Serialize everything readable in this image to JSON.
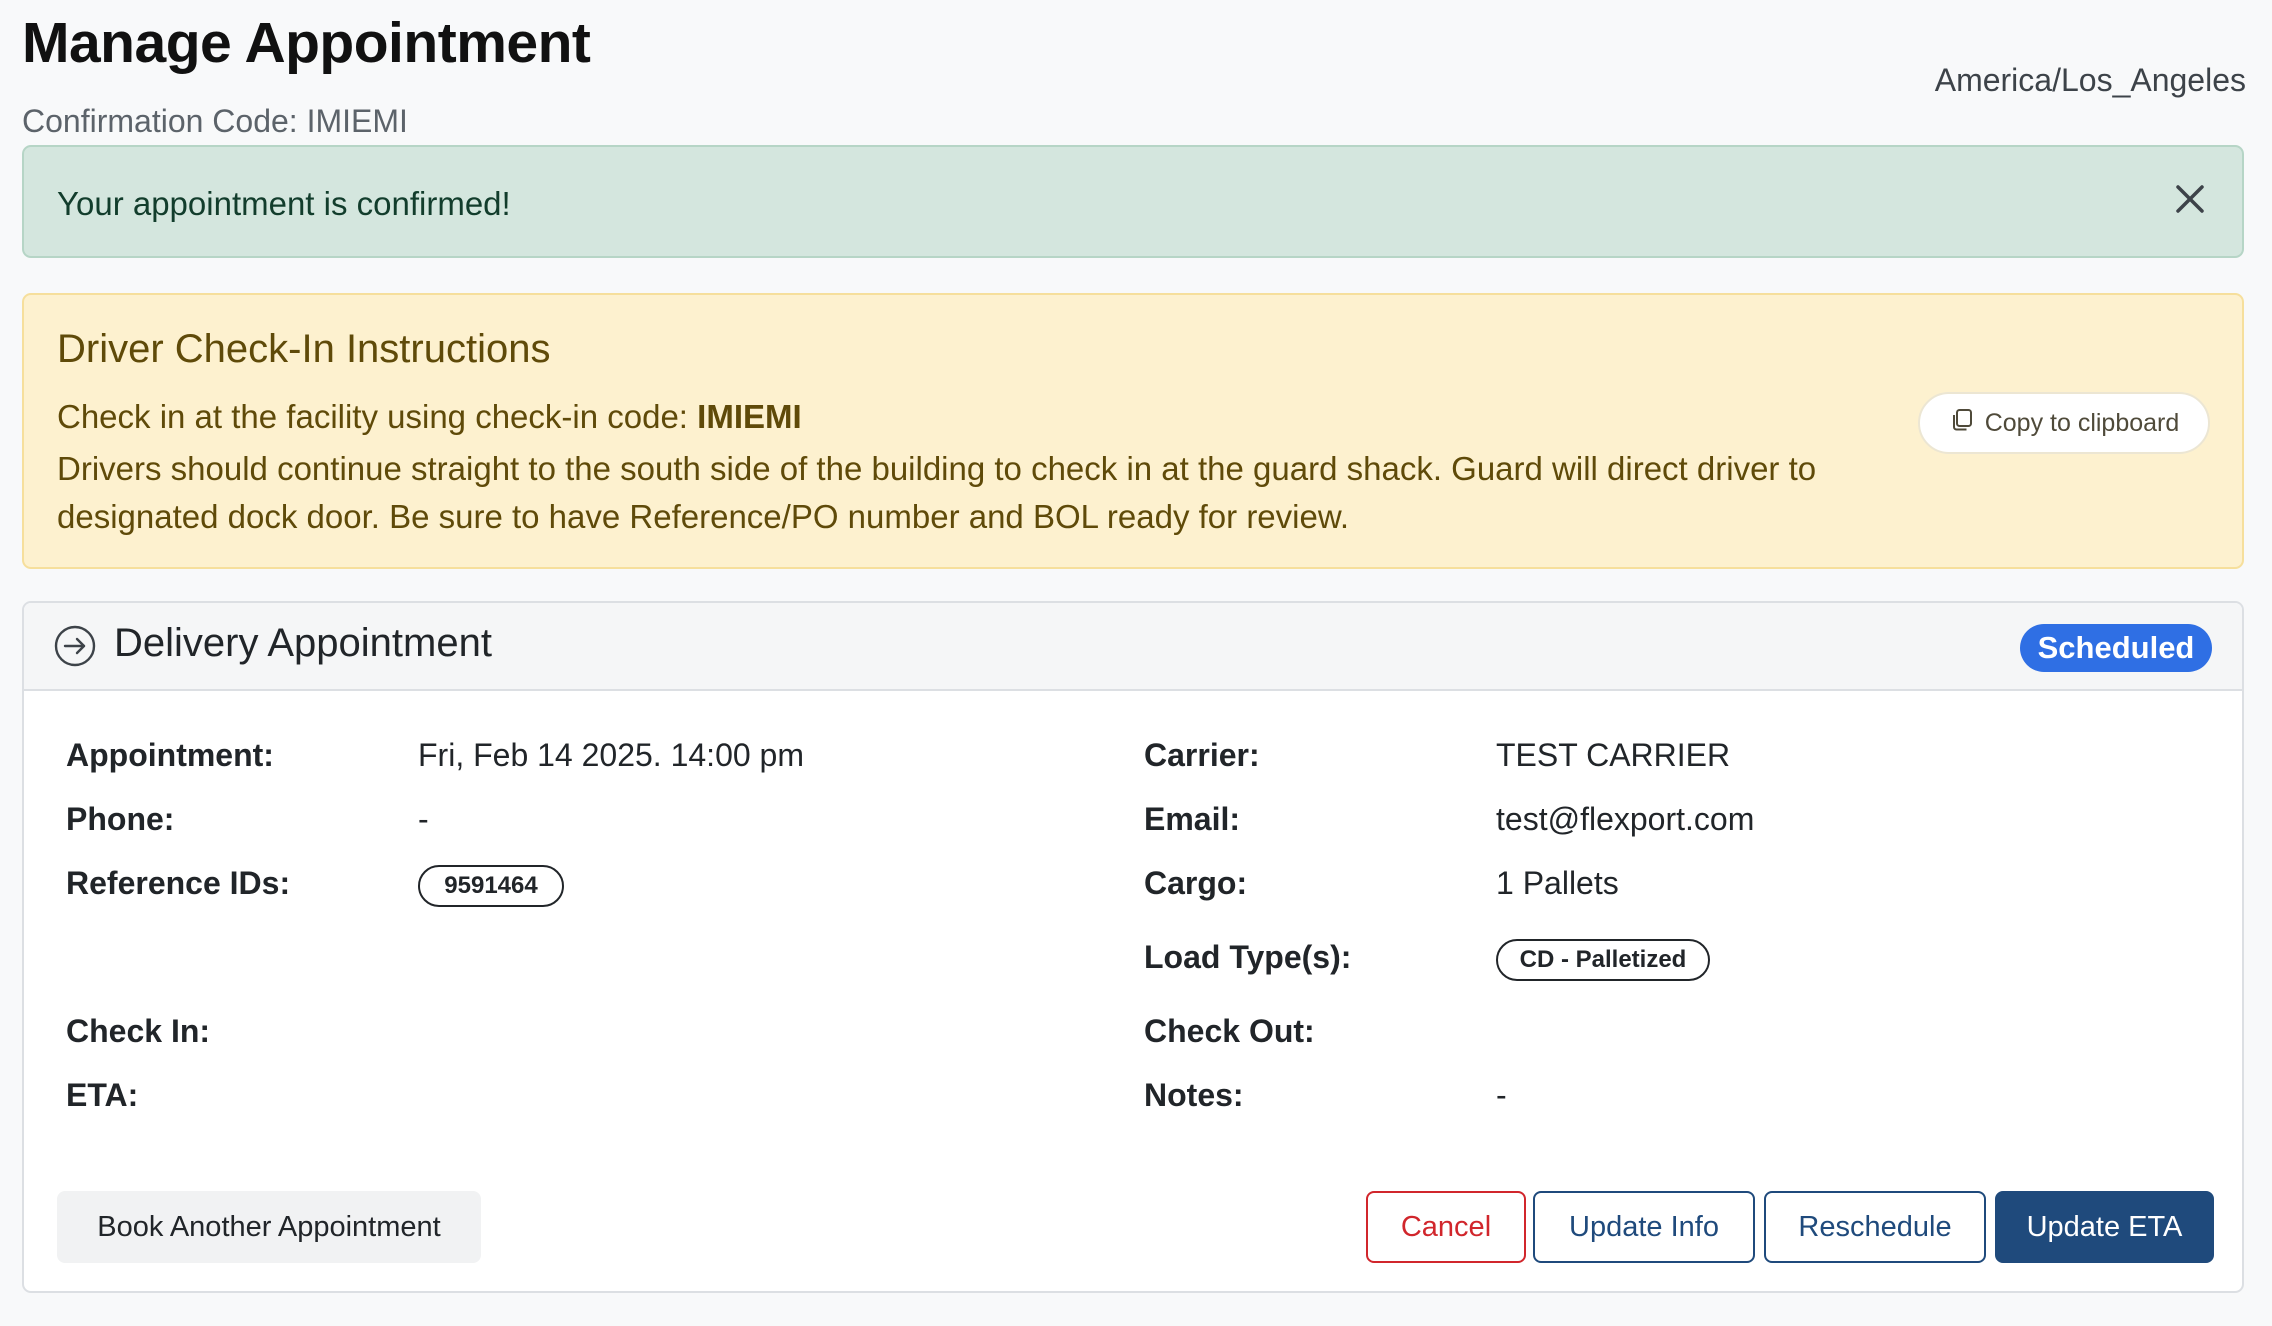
{
  "header": {
    "title": "Manage Appointment",
    "confirmation_label": "Confirmation Code:",
    "confirmation_code": "IMIEMI",
    "timezone": "America/Los_Angeles"
  },
  "success_alert": {
    "message": "Your appointment is confirmed!",
    "close_icon": "close-icon"
  },
  "instructions": {
    "title": "Driver Check-In Instructions",
    "checkin_prefix": "Check in at the facility using check-in code:",
    "checkin_code": "IMIEMI",
    "body": "Drivers should continue straight to the south side of the building to check in at the guard shack. Guard will direct driver to designated dock door. Be sure to have Reference/PO number and BOL ready for review.",
    "copy_button": "Copy to clipboard",
    "copy_icon": "copy-icon"
  },
  "appointment": {
    "title": "Delivery Appointment",
    "icon": "arrow-circle-right-icon",
    "status": "Scheduled",
    "status_color": "#2f6fe4",
    "left_fields": {
      "appointment_label": "Appointment:",
      "appointment_value": "Fri, Feb 14 2025. 14:00 pm",
      "phone_label": "Phone:",
      "phone_value": "-",
      "reference_label": "Reference IDs:",
      "reference_value": "9591464",
      "checkin_label": "Check In:",
      "eta_label": "ETA:"
    },
    "right_fields": {
      "carrier_label": "Carrier:",
      "carrier_value": "TEST CARRIER",
      "email_label": "Email:",
      "email_value": "test@flexport.com",
      "cargo_label": "Cargo:",
      "cargo_value": "1 Pallets",
      "loadtype_label": "Load Type(s):",
      "loadtype_value": "CD - Palletized",
      "checkout_label": "Check Out:",
      "notes_label": "Notes:",
      "notes_value": "-"
    },
    "buttons": {
      "book_another": "Book Another Appointment",
      "cancel": "Cancel",
      "update_info": "Update Info",
      "reschedule": "Reschedule",
      "update_eta": "Update ETA"
    }
  },
  "colors": {
    "primary": "#1f4a7c",
    "danger": "#d1262c",
    "success_bg": "#d4e6de",
    "warning_bg": "#fdf1cf"
  }
}
